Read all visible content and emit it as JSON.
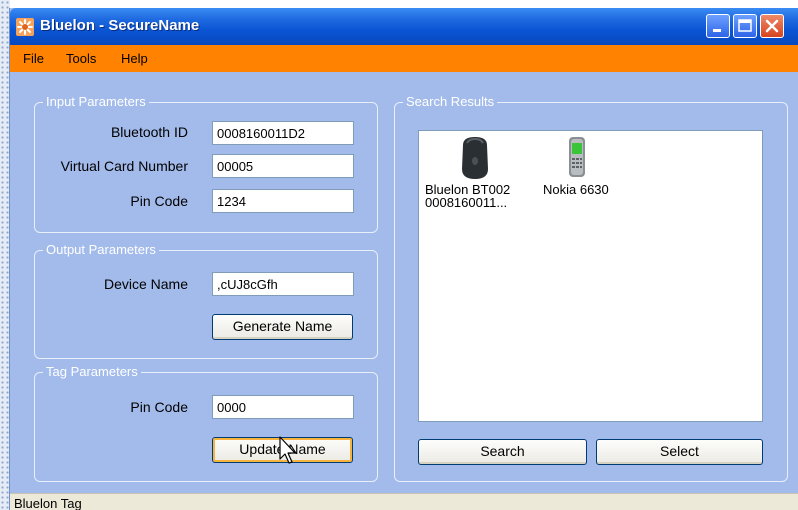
{
  "window": {
    "title": "Bluelon - SecureName",
    "controls": {
      "minimize": "minimize",
      "maximize": "maximize",
      "close": "close"
    }
  },
  "menu": [
    "File",
    "Tools",
    "Help"
  ],
  "input_parameters": {
    "title": "Input Parameters",
    "bluetooth_id": {
      "label": "Bluetooth ID",
      "value": "0008160011D2"
    },
    "virtual_card_number": {
      "label": "Virtual Card Number",
      "value": "00005"
    },
    "pin_code": {
      "label": "Pin Code",
      "value": "1234"
    }
  },
  "output_parameters": {
    "title": "Output Parameters",
    "device_name": {
      "label": "Device Name",
      "value": ",cUJ8cGfh"
    },
    "generate_button": "Generate  Name"
  },
  "tag_parameters": {
    "title": "Tag Parameters",
    "pin_code": {
      "label": "Pin Code",
      "value": "0000"
    },
    "update_button": "Update Name"
  },
  "search_results": {
    "title": "Search Results",
    "devices": [
      {
        "name": "Bluelon BT002",
        "sub": "0008160011...",
        "icon": "bluetooth-tag-icon"
      },
      {
        "name": "Nokia 6630",
        "sub": "",
        "icon": "mobile-phone-icon"
      }
    ],
    "search_button": "Search",
    "select_button": "Select"
  },
  "status_bar": {
    "text": "Bluelon Tag"
  },
  "colors": {
    "window_background": "#a3bbeb",
    "titlebar": "#0a55d4",
    "menubar": "#ff8300",
    "statusbar": "#ece9d8"
  }
}
